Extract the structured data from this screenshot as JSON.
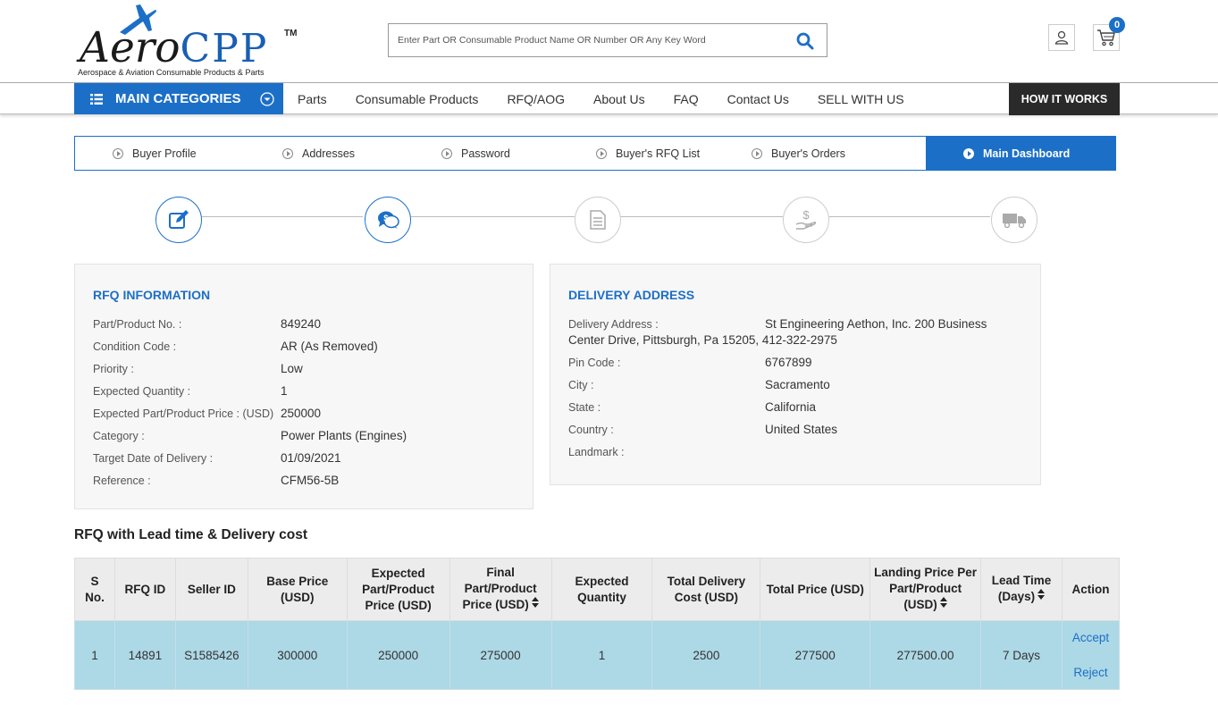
{
  "logo": {
    "name_part1": "Aero",
    "name_part2": "CPP",
    "trademark": "TM",
    "tagline": "Aerospace & Aviation Consumable Products & Parts"
  },
  "search": {
    "placeholder": "Enter Part OR Consumable Product Name OR Number OR Any Key Word"
  },
  "cart": {
    "count": "0"
  },
  "nav": {
    "main_categories": "MAIN CATEGORIES",
    "links": [
      "Parts",
      "Consumable Products",
      "RFQ/AOG",
      "About Us",
      "FAQ",
      "Contact Us",
      "SELL WITH US"
    ],
    "how_it_works": "HOW IT WORKS"
  },
  "tabs": [
    {
      "label": "Buyer Profile",
      "active": false
    },
    {
      "label": "Addresses",
      "active": false
    },
    {
      "label": "Password",
      "active": false
    },
    {
      "label": "Buyer's RFQ List",
      "active": false
    },
    {
      "label": "Buyer's Orders",
      "active": false
    },
    {
      "label": "Main Dashboard",
      "active": true
    }
  ],
  "steps": [
    {
      "icon": "edit-icon",
      "done": true
    },
    {
      "icon": "quote-chat-icon",
      "done": true
    },
    {
      "icon": "document-icon",
      "done": false
    },
    {
      "icon": "payment-hand-icon",
      "done": false
    },
    {
      "icon": "truck-icon",
      "done": false
    }
  ],
  "rfq_info": {
    "title": "RFQ INFORMATION",
    "rows": [
      {
        "label": "Part/Product No. :",
        "value": "849240"
      },
      {
        "label": "Condition Code :",
        "value": "AR (As Removed)"
      },
      {
        "label": "Priority :",
        "value": "Low"
      },
      {
        "label": "Expected Quantity :",
        "value": "1"
      },
      {
        "label": "Expected Part/Product Price : (USD)",
        "value": "250000"
      },
      {
        "label": "Category :",
        "value": "Power Plants (Engines)"
      },
      {
        "label": "Target Date of Delivery :",
        "value": "01/09/2021"
      },
      {
        "label": "Reference :",
        "value": "CFM56-5B"
      }
    ]
  },
  "delivery": {
    "title": "DELIVERY ADDRESS",
    "address_label": "Delivery Address :",
    "address_line1": "St Engineering Aethon, Inc. 200 Business",
    "address_line2": "Center Drive, Pittsburgh, Pa 15205, 412-322-2975",
    "rows": [
      {
        "label": "Pin Code :",
        "value": "6767899"
      },
      {
        "label": "City :",
        "value": "Sacramento"
      },
      {
        "label": "State :",
        "value": "California"
      },
      {
        "label": "Country :",
        "value": "United States"
      },
      {
        "label": "Landmark :",
        "value": ""
      }
    ]
  },
  "table": {
    "title": "RFQ with Lead time & Delivery cost",
    "headers": [
      {
        "lines": [
          "S",
          "No."
        ],
        "sortable": false
      },
      {
        "lines": [
          "RFQ ID"
        ],
        "sortable": false
      },
      {
        "lines": [
          "Seller ID"
        ],
        "sortable": false
      },
      {
        "lines": [
          "Base Price",
          "(USD)"
        ],
        "sortable": false
      },
      {
        "lines": [
          "Expected",
          "Part/Product",
          "Price (USD)"
        ],
        "sortable": false
      },
      {
        "lines": [
          "Final",
          "Part/Product",
          "Price (USD)"
        ],
        "sortable": true
      },
      {
        "lines": [
          "Expected",
          "Quantity"
        ],
        "sortable": false
      },
      {
        "lines": [
          "Total Delivery",
          "Cost (USD)"
        ],
        "sortable": false
      },
      {
        "lines": [
          "Total Price (USD)"
        ],
        "sortable": false
      },
      {
        "lines": [
          "Landing Price Per",
          "Part/Product",
          "(USD)"
        ],
        "sortable": true
      },
      {
        "lines": [
          "Lead Time",
          "(Days)"
        ],
        "sortable": true
      },
      {
        "lines": [
          "Action"
        ],
        "sortable": false
      }
    ],
    "rows": [
      {
        "cells": [
          "1",
          "14891",
          "S1585426",
          "300000",
          "250000",
          "275000",
          "1",
          "2500",
          "277500",
          "277500.00",
          "7 Days"
        ],
        "accept": "Accept",
        "reject": "Reject"
      }
    ]
  },
  "colors": {
    "primary": "#1c6fc7",
    "dark": "#2a2a2a",
    "row_bg": "#add8e6",
    "panel_bg": "#f7f7f7"
  }
}
